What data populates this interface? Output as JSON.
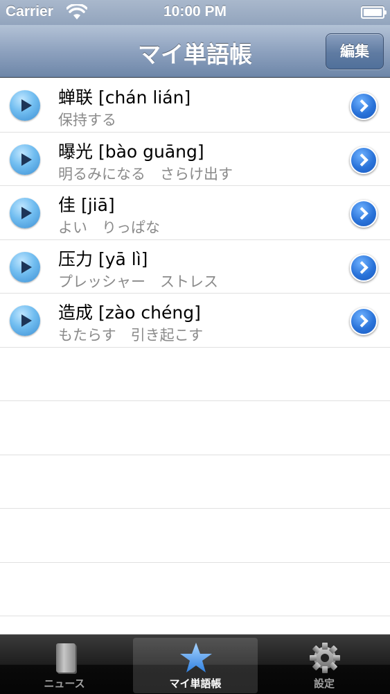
{
  "status_bar": {
    "carrier": "Carrier",
    "time": "10:00 PM"
  },
  "nav_bar": {
    "title": "マイ単語帳",
    "edit_label": "編集"
  },
  "words": [
    {
      "word": "蝉联 [chán lián]",
      "meaning": "保持する"
    },
    {
      "word": "曝光 [bào guāng]",
      "meaning": "明るみになる　さらけ出す"
    },
    {
      "word": "佳 [jiā]",
      "meaning": "よい　りっぱな"
    },
    {
      "word": "压力 [yā lì]",
      "meaning": "プレッシャー　ストレス"
    },
    {
      "word": "造成 [zào chéng]",
      "meaning": "もたらす　引き起こす"
    }
  ],
  "tab_bar": {
    "tabs": [
      {
        "label": "ニュース",
        "icon": "book-icon",
        "selected": false
      },
      {
        "label": "マイ単語帳",
        "icon": "star-icon",
        "selected": true
      },
      {
        "label": "設定",
        "icon": "gear-icon",
        "selected": false
      }
    ]
  },
  "colors": {
    "nav": "#7d92b2",
    "accent": "#2a73d9",
    "tab_bar": "#1a1a1a"
  }
}
